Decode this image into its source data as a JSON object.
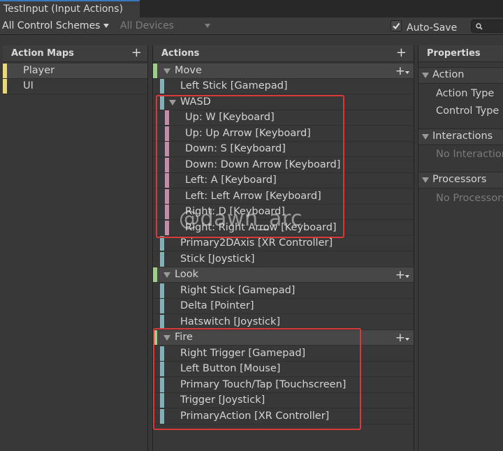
{
  "window": {
    "tab_title": "TestInput (Input Actions)"
  },
  "toolbar": {
    "control_schemes": "All Control Schemes",
    "devices": "All Devices",
    "auto_save_label": "Auto-Save",
    "auto_save_checked": true
  },
  "action_maps": {
    "title": "Action Maps",
    "items": [
      {
        "label": "Player",
        "selected": true
      },
      {
        "label": "UI",
        "selected": false
      }
    ]
  },
  "actions": {
    "title": "Actions",
    "rows": [
      {
        "label": "Move",
        "kind": "action"
      },
      {
        "label": "Left Stick [Gamepad]",
        "kind": "binding"
      },
      {
        "label": "WASD",
        "kind": "composite"
      },
      {
        "label": "Up: W [Keyboard]",
        "kind": "part"
      },
      {
        "label": "Up: Up Arrow [Keyboard]",
        "kind": "part"
      },
      {
        "label": "Down: S [Keyboard]",
        "kind": "part"
      },
      {
        "label": "Down: Down Arrow [Keyboard]",
        "kind": "part"
      },
      {
        "label": "Left: A [Keyboard]",
        "kind": "part"
      },
      {
        "label": "Left: Left Arrow [Keyboard]",
        "kind": "part"
      },
      {
        "label": "Right: D [Keyboard]",
        "kind": "part"
      },
      {
        "label": "Right: Right Arrow [Keyboard]",
        "kind": "part"
      },
      {
        "label": "Primary2DAxis [XR Controller]",
        "kind": "binding"
      },
      {
        "label": "Stick [Joystick]",
        "kind": "binding"
      },
      {
        "label": "Look",
        "kind": "action"
      },
      {
        "label": "Right Stick [Gamepad]",
        "kind": "binding"
      },
      {
        "label": "Delta [Pointer]",
        "kind": "binding"
      },
      {
        "label": "Hatswitch [Joystick]",
        "kind": "binding"
      },
      {
        "label": "Fire",
        "kind": "action"
      },
      {
        "label": "Right Trigger [Gamepad]",
        "kind": "binding"
      },
      {
        "label": "Left Button [Mouse]",
        "kind": "binding"
      },
      {
        "label": "Primary Touch/Tap [Touchscreen]",
        "kind": "binding"
      },
      {
        "label": "Trigger [Joystick]",
        "kind": "binding"
      },
      {
        "label": "PrimaryAction [XR Controller]",
        "kind": "binding"
      }
    ]
  },
  "properties": {
    "title": "Properties",
    "action_section": "Action",
    "action_type": "Action Type",
    "control_type": "Control Type",
    "interactions_section": "Interactions",
    "no_interactions": "No Interactions",
    "processors_section": "Processors",
    "no_processors": "No Processors"
  },
  "watermark": "@dawn_arc",
  "colors": {
    "map_strip": "#e9d77b",
    "action_strip": "#9fcd8a",
    "binding_strip": "#7fb1b5",
    "part_strip": "#c48ea8",
    "highlight": "#d83a3a"
  }
}
